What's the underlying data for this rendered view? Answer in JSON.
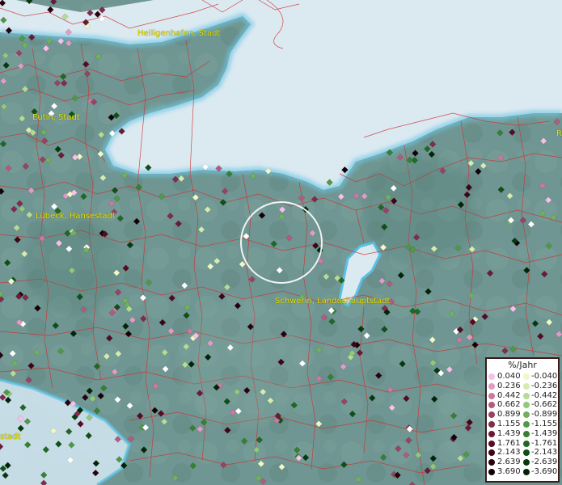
{
  "map": {
    "cities": [
      {
        "name": "Heiligenhafen, Stadt",
        "pos": [
          170,
          36
        ]
      },
      {
        "name": "Eutin, Stadt",
        "pos": [
          40,
          140
        ]
      },
      {
        "name": "Lübeck, Hansestadt",
        "pos": [
          44,
          262
        ]
      },
      {
        "name": "Schwerin, Landeshauptstadt",
        "pos": [
          340,
          367
        ]
      },
      {
        "name": "stadt",
        "pos": [
          0,
          535
        ]
      },
      {
        "name": "R",
        "pos": [
          688,
          160
        ]
      }
    ]
  },
  "legend": {
    "title": "%/Jahr",
    "positive": [
      {
        "label": "0.040",
        "color": "#f8c0e8"
      },
      {
        "label": "0.236",
        "color": "#e09cc4"
      },
      {
        "label": "0.442",
        "color": "#c87aa0"
      },
      {
        "label": "0.662",
        "color": "#b05c80"
      },
      {
        "label": "0.899",
        "color": "#984266"
      },
      {
        "label": "1.155",
        "color": "#802c4c"
      },
      {
        "label": "1.439",
        "color": "#6a1a38"
      },
      {
        "label": "1.761",
        "color": "#540c26"
      },
      {
        "label": "2.143",
        "color": "#3e0418"
      },
      {
        "label": "2.639",
        "color": "#2a000e"
      },
      {
        "label": "3.690",
        "color": "#160006"
      }
    ],
    "negative": [
      {
        "label": "-0.040",
        "color": "#f0f8c8"
      },
      {
        "label": "-0.236",
        "color": "#d4ecb0"
      },
      {
        "label": "-0.442",
        "color": "#b4dc96"
      },
      {
        "label": "-0.662",
        "color": "#92c87a"
      },
      {
        "label": "-0.899",
        "color": "#70b05e"
      },
      {
        "label": "-1.155",
        "color": "#509846"
      },
      {
        "label": "-1.439",
        "color": "#368032"
      },
      {
        "label": "-1.761",
        "color": "#206824"
      },
      {
        "label": "-2.143",
        "color": "#105018"
      },
      {
        "label": "-2.639",
        "color": "#063a0e"
      },
      {
        "label": "-3.690",
        "color": "#022406"
      }
    ]
  }
}
